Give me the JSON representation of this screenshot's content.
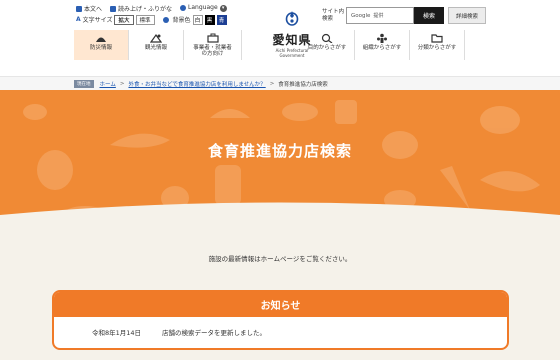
{
  "utility": {
    "text_only": "本文へ",
    "read_aloud": "読み上げ・ふりがな",
    "language": "Language",
    "text_size_label": "文字サイズ",
    "size_large": "拡大",
    "size_standard": "標準",
    "bg_color_label": "背景色",
    "bg_white": "白",
    "bg_black": "黒",
    "bg_blue": "青"
  },
  "logo": {
    "name": "愛知県",
    "sub": "Aichi Prefectural Government"
  },
  "search": {
    "label": "サイト内検索",
    "placeholder_brand": "Google",
    "placeholder_text": "提供",
    "button": "検索",
    "advanced": "詳細検索"
  },
  "global_nav": [
    {
      "label": "防災情報",
      "icon": "disaster-prevention-icon"
    },
    {
      "label": "観光情報",
      "icon": "tourism-icon"
    },
    {
      "label": "事業者・就業者の方向け",
      "icon": "business-icon"
    },
    {
      "label": "目的からさがす",
      "icon": "purpose-search-icon"
    },
    {
      "label": "組織からさがす",
      "icon": "organization-icon"
    },
    {
      "label": "分類からさがす",
      "icon": "category-icon"
    }
  ],
  "breadcrumb": {
    "tag": "現在地",
    "home": "ホーム",
    "parent": "外食・お弁当などで食育推進協力店を利用しませんか？",
    "current": "食育推進協力店検索"
  },
  "hero": {
    "title": "食育推進協力店検索"
  },
  "message": "施設の最新情報はホームページをご覧ください。",
  "notice": {
    "heading": "お知らせ",
    "items": [
      {
        "date": "令和8年1月14日",
        "text": "店舗の検索データを更新しました。"
      }
    ]
  },
  "colors": {
    "accent_orange": "#f07a28",
    "hero_orange": "#f08a35",
    "page_bg": "#f5f2ea"
  }
}
